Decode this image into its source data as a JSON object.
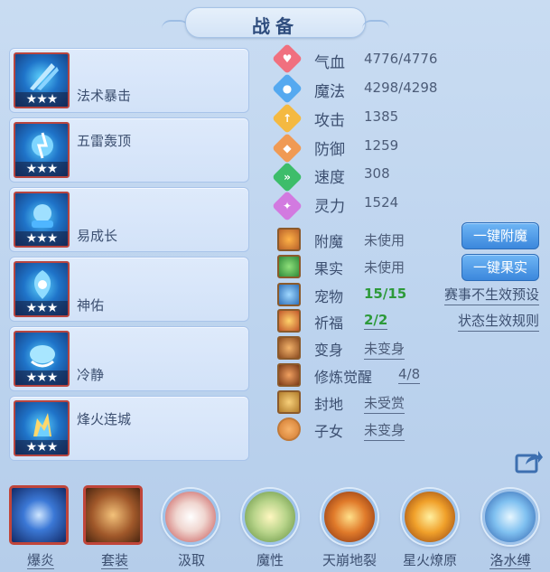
{
  "title": "战备",
  "equipment": [
    {
      "name": "法术暴击",
      "stars": "★★★"
    },
    {
      "name": "五雷轰顶",
      "stars": "★★★"
    },
    {
      "name": "易成长",
      "stars": "★★★"
    },
    {
      "name": "神佑",
      "stars": "★★★"
    },
    {
      "name": "冷静",
      "stars": "★★★"
    },
    {
      "name": "烽火连城",
      "stars": "★★★"
    }
  ],
  "stats": [
    {
      "label": "气血",
      "value": "4776/4776",
      "icon": "heart-icon",
      "color": "#f0707f"
    },
    {
      "label": "魔法",
      "value": "4298/4298",
      "icon": "mana-icon",
      "color": "#55a9f0"
    },
    {
      "label": "攻击",
      "value": "1385",
      "icon": "sword-icon",
      "color": "#f4b941"
    },
    {
      "label": "防御",
      "value": "1259",
      "icon": "shield-icon",
      "color": "#f09a54"
    },
    {
      "label": "速度",
      "value": "308",
      "icon": "speed-icon",
      "color": "#3dbd6a"
    },
    {
      "label": "灵力",
      "value": "1524",
      "icon": "spirit-icon",
      "color": "#d27ae0"
    }
  ],
  "status": [
    {
      "label": "附魔",
      "value": "未使用",
      "icon": "enchant-icon"
    },
    {
      "label": "果实",
      "value": "未使用",
      "icon": "fruit-icon"
    },
    {
      "label": "宠物",
      "value": "15/15",
      "icon": "pet-icon"
    },
    {
      "label": "祈福",
      "value": "2/2",
      "icon": "blessing-icon"
    },
    {
      "label": "变身",
      "value": "未变身",
      "icon": "transform-icon"
    },
    {
      "label": "修炼觉醒",
      "value": "4/8",
      "icon": "cultivation-icon"
    },
    {
      "label": "封地",
      "value": "未受赏",
      "icon": "fief-icon"
    },
    {
      "label": "子女",
      "value": "未变身",
      "icon": "children-icon"
    }
  ],
  "buttons": {
    "enchant": "一键附魔",
    "fruit": "一键果实"
  },
  "links": {
    "preset": "赛事不生效预设",
    "rules": "状态生效规则"
  },
  "skills": [
    {
      "label": "爆炎"
    },
    {
      "label": "套装"
    },
    {
      "label": "汲取"
    },
    {
      "label": "魔性"
    },
    {
      "label": "天崩地裂"
    },
    {
      "label": "星火燎原"
    },
    {
      "label": "洛水缚"
    }
  ],
  "colors": {
    "accent_blue": "#3b87dc",
    "green_value": "#2d9a3a",
    "frame_red": "#c0453a"
  }
}
